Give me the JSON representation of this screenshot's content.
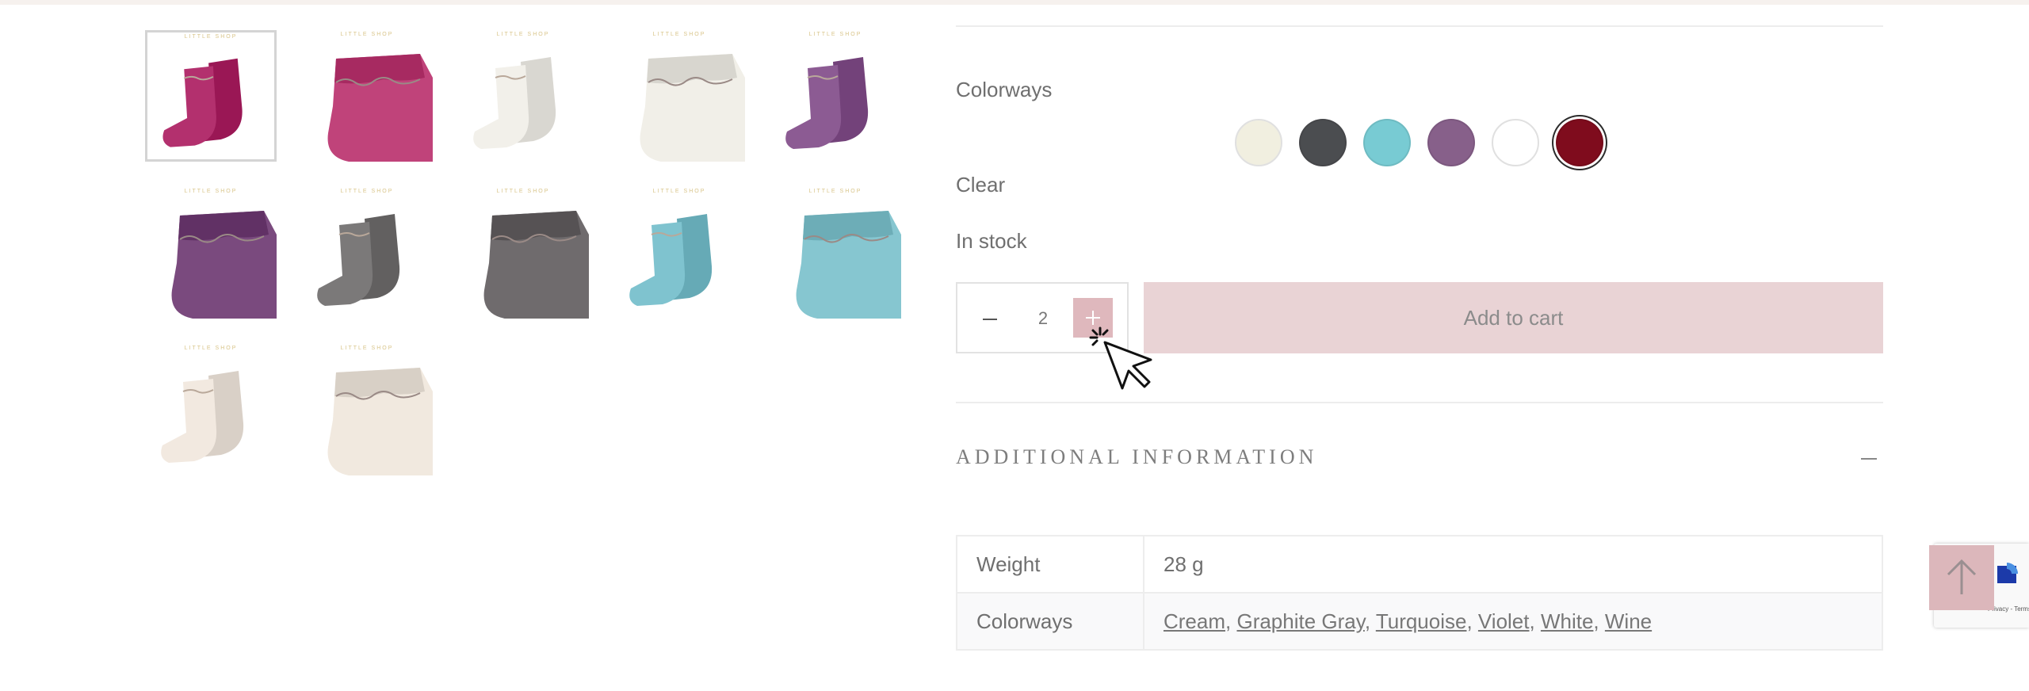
{
  "gallery": {
    "brand_mark": "LITTLE SHOP",
    "thumbnails": [
      {
        "name": "wine-sock-pair-thumbnail",
        "color": "#b3306e"
      },
      {
        "name": "wine-sock-folded-thumbnail",
        "color": "#c0437a"
      },
      {
        "name": "cream-sock-pair-thumbnail",
        "color": "#f2f0ea"
      },
      {
        "name": "cream-sock-folded-thumbnail",
        "color": "#f1efe8"
      },
      {
        "name": "violet-sock-pair-thumbnail",
        "color": "#8c5b93"
      },
      {
        "name": "violet-sock-folded-thumbnail",
        "color": "#7a4a7e"
      },
      {
        "name": "graphite-sock-pair-thumbnail",
        "color": "#7b7979"
      },
      {
        "name": "graphite-sock-folded-thumbnail",
        "color": "#6f6b6d"
      },
      {
        "name": "turquoise-sock-pair-thumbnail",
        "color": "#7fc3cf"
      },
      {
        "name": "turquoise-sock-folded-thumbnail",
        "color": "#86c6d0"
      },
      {
        "name": "white-sock-pair-thumbnail",
        "color": "#f2e9e0"
      },
      {
        "name": "white-sock-folded-thumbnail",
        "color": "#f1e9df"
      }
    ]
  },
  "product": {
    "colorways_label": "Colorways",
    "swatches": [
      {
        "name": "Cream",
        "color": "#f1efe0",
        "selected": false
      },
      {
        "name": "Graphite Gray",
        "color": "#4b4d50",
        "selected": false
      },
      {
        "name": "Turquoise",
        "color": "#78cbd3",
        "selected": false
      },
      {
        "name": "Violet",
        "color": "#87608a",
        "selected": false
      },
      {
        "name": "White",
        "color": "#ffffff",
        "selected": false
      },
      {
        "name": "Wine",
        "color": "#7f0c1d",
        "selected": true
      }
    ],
    "clear_label": "Clear",
    "stock_status": "In stock",
    "quantity": "2",
    "add_to_cart_label": "Add to cart"
  },
  "additional_info": {
    "title": "ADDITIONAL INFORMATION",
    "rows": [
      {
        "key": "Weight",
        "value": "28 g"
      },
      {
        "key": "Colorways",
        "links": [
          "Cream",
          "Graphite Gray",
          "Turquoise",
          "Violet",
          "White",
          "Wine"
        ]
      }
    ]
  },
  "colors": {
    "accent_pink": "#dfb8bd",
    "add_to_cart_bg": "#e9d3d5",
    "text_gray": "#6f6f6f"
  },
  "icons": {
    "back_to_top": "arrow-up-icon",
    "cursor": "mouse-pointer-icon",
    "recaptcha": "recaptcha-logo-icon"
  }
}
